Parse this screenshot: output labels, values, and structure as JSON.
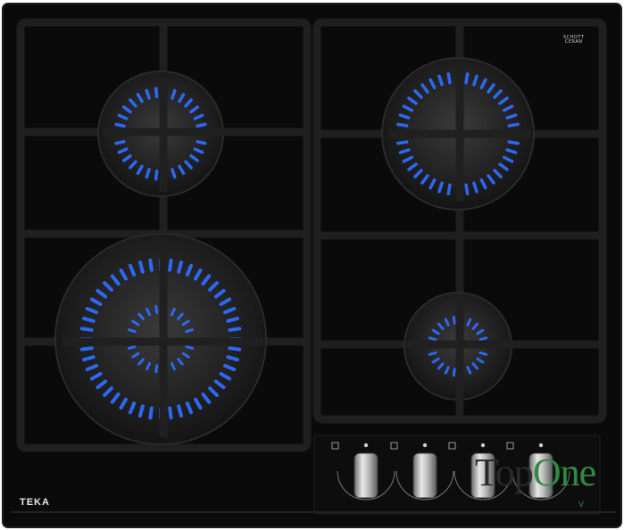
{
  "product": {
    "brand": "TEKA",
    "glass_maker_line1": "SCHOTT",
    "glass_maker_line2": "CERAN"
  },
  "watermark": {
    "part1": "Top",
    "part2": "One",
    "sub": "V"
  },
  "burners": [
    {
      "name": "rear-left-burner",
      "flame": "blue"
    },
    {
      "name": "front-left-wok-burner",
      "flame": "blue"
    },
    {
      "name": "rear-right-burner",
      "flame": "blue"
    },
    {
      "name": "front-right-burner",
      "flame": "blue"
    }
  ],
  "controls": {
    "knob_count": 4
  },
  "colors": {
    "glass": "#0b0b0b",
    "grate": "#1a1a1a",
    "flame": "#2f6bff",
    "knob": "#b9b9b9",
    "watermark": "#2f8a45"
  }
}
